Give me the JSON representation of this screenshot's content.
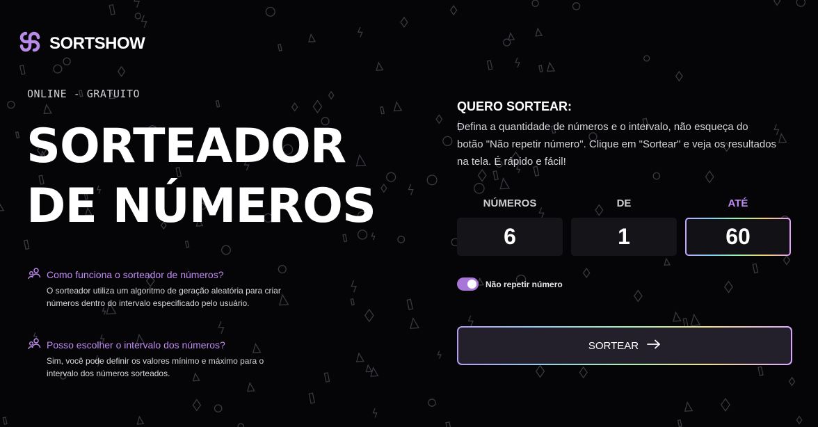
{
  "brand": {
    "name": "SORTSHOW",
    "logo_icon": "sortshow-logo-icon",
    "accent": "#c08cf2"
  },
  "hero": {
    "eyebrow": "ONLINE - GRATUITO",
    "title_line1": "SORTEADOR",
    "title_line2": "DE NÚMEROS"
  },
  "faq": [
    {
      "icon": "people-icon",
      "question": "Como funciona o sorteador de números?",
      "answer_line1": "O sorteador utiliza um algoritmo de geração aleatória para criar",
      "answer_line2": "números dentro do intervalo especificado pelo usuário."
    },
    {
      "icon": "people-icon",
      "question": "Posso escolher o intervalo dos números?",
      "answer_line1": "Sim, você pode definir os valores mínimo e máximo para o",
      "answer_line2": "intervalo dos números sorteados."
    }
  ],
  "form": {
    "title": "QUERO SORTEAR:",
    "description": "Defina a quantidade de números e o intervalo, não esqueça do botão \"Não repetir número\". Clique em \"Sortear\" e veja os resultados na tela. É rápido e fácil!",
    "fields": [
      {
        "label": "NÚMEROS",
        "value": "6"
      },
      {
        "label": "DE",
        "value": "1"
      },
      {
        "label": "ATÉ",
        "value": "60"
      }
    ],
    "no_repeat": {
      "label": "Não repetir número",
      "enabled": true
    },
    "submit_label": "SORTEAR",
    "submit_icon": "arrow-right-icon"
  }
}
